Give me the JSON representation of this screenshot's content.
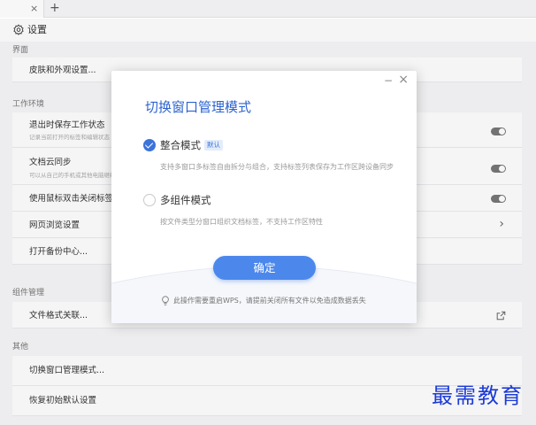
{
  "tabbar": {
    "close_glyph": "×",
    "add_glyph": "+"
  },
  "header": {
    "icon": "gear-icon",
    "title": "设置"
  },
  "sections": {
    "appearance": {
      "label": "界面",
      "items": [
        {
          "title": "皮肤和外观设置..."
        }
      ]
    },
    "workspace": {
      "label": "工作环境",
      "items": [
        {
          "title": "退出时保存工作状态",
          "subtitle": "记录当前打开的标签和编辑状态",
          "toggle": "off"
        },
        {
          "title": "文档云同步",
          "subtitle": "可以从自己的手机或其他电脑继续",
          "toggle": "off"
        },
        {
          "title": "使用鼠标双击关闭标签",
          "toggle": "off"
        },
        {
          "title": "网页浏览设置",
          "chevron": "›"
        },
        {
          "title": "打开备份中心..."
        }
      ]
    },
    "components": {
      "label": "组件管理",
      "items": [
        {
          "title": "文件格式关联...",
          "icon": "external-link-icon"
        }
      ]
    },
    "other": {
      "label": "其他",
      "items": [
        {
          "title": "切换窗口管理模式..."
        },
        {
          "title": "恢复初始默认设置"
        }
      ]
    }
  },
  "modal": {
    "min_glyph": "−",
    "close_glyph": "×",
    "title": "切换窗口管理模式",
    "options": [
      {
        "label": "整合模式",
        "badge": "默认",
        "description": "支持多窗口多标签自由拆分与组合，支持标签列表保存为工作区跨设备同步",
        "selected": true
      },
      {
        "label": "多组件模式",
        "description": "按文件类型分窗口组织文档标签，不支持工作区特性",
        "selected": false
      }
    ],
    "confirm_label": "确定",
    "note": "此操作需要重启WPS，请提前关闭所有文件以免造成数据丢失",
    "accent_color": "#3b73d9"
  },
  "watermark": "最需教育"
}
